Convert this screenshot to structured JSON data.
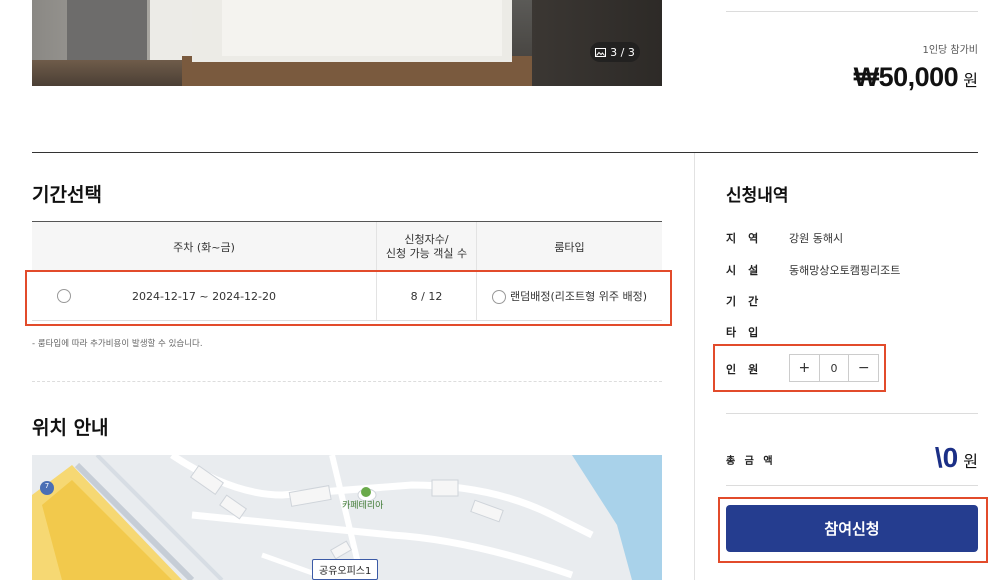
{
  "gallery": {
    "counter": "3 / 3",
    "icon": "image-icon"
  },
  "price": {
    "per_person_label": "1인당 참가비",
    "amount": "₩50,000",
    "unit": "원"
  },
  "period": {
    "title": "기간선택",
    "columns": [
      "주차 (화~금)",
      "신청자수/\n신청 가능 객실 수",
      "룸타입"
    ],
    "rows": [
      {
        "dates": "2024-12-17 ~ 2024-12-20",
        "count": "8 / 12",
        "room_type": "랜덤배정(리조트형 위주 배정)"
      }
    ],
    "note": "-  룸타입에 따라 추가비용이 발생할 수 있습니다."
  },
  "location": {
    "title": "위치 안내",
    "map_labels": {
      "cafeteria": "카페테리아",
      "office": "공유오피스1",
      "road_badge": "7"
    }
  },
  "summary": {
    "title": "신청내역",
    "rows": [
      {
        "label": "지역",
        "value": "강원 동해시"
      },
      {
        "label": "시설",
        "value": "동해망상오토캠핑리조트"
      },
      {
        "label": "기간",
        "value": ""
      },
      {
        "label": "타입",
        "value": ""
      }
    ],
    "people": {
      "label": "인원",
      "plus": "+",
      "value": "0",
      "minus": "−"
    },
    "total": {
      "label": "총 금 액",
      "amount": "\\0",
      "unit": "원"
    },
    "apply_label": "참여신청"
  }
}
